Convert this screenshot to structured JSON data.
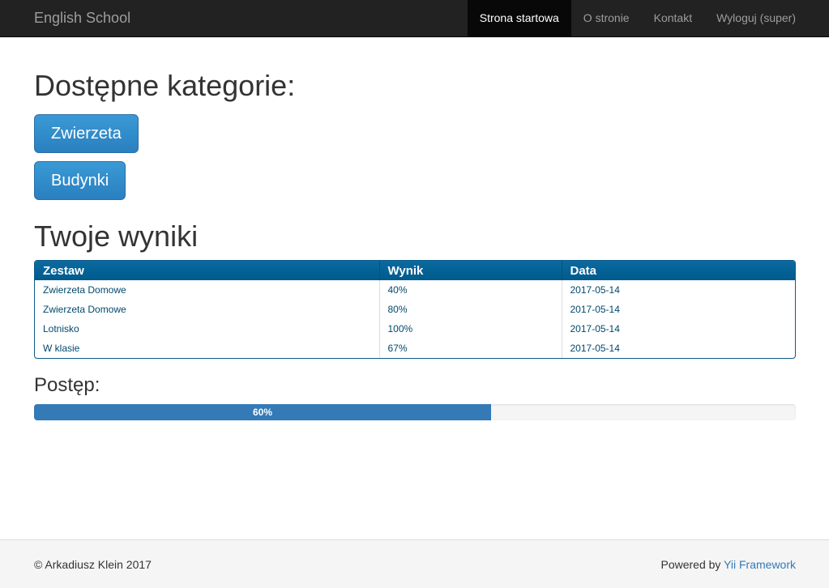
{
  "navbar": {
    "brand": "English School",
    "items": [
      {
        "label": "Strona startowa",
        "active": true
      },
      {
        "label": "O stronie",
        "active": false
      },
      {
        "label": "Kontakt",
        "active": false
      },
      {
        "label": "Wyloguj (super)",
        "active": false
      }
    ]
  },
  "main": {
    "categories_title": "Dostępne kategorie:",
    "categories": [
      "Zwierzeta",
      "Budynki"
    ],
    "results_title": "Twoje wyniki",
    "table": {
      "headers": [
        "Zestaw",
        "Wynik",
        "Data"
      ],
      "rows": [
        [
          "Zwierzeta Domowe",
          "40%",
          "2017-05-14"
        ],
        [
          "Zwierzeta Domowe",
          "80%",
          "2017-05-14"
        ],
        [
          "Lotnisko",
          "100%",
          "2017-05-14"
        ],
        [
          "W klasie",
          "67%",
          "2017-05-14"
        ]
      ]
    },
    "progress": {
      "label": "Postęp:",
      "value_percent": 60,
      "text": "60%"
    }
  },
  "footer": {
    "copyright": "© Arkadiusz Klein 2017",
    "powered_prefix": "Powered by ",
    "powered_link": "Yii Framework"
  },
  "colors": {
    "navbar_bg": "#222222",
    "primary_button": "#2a7fbf",
    "table_header": "#005a8c",
    "progress_bar": "#337ab7",
    "link": "#337ab7"
  }
}
